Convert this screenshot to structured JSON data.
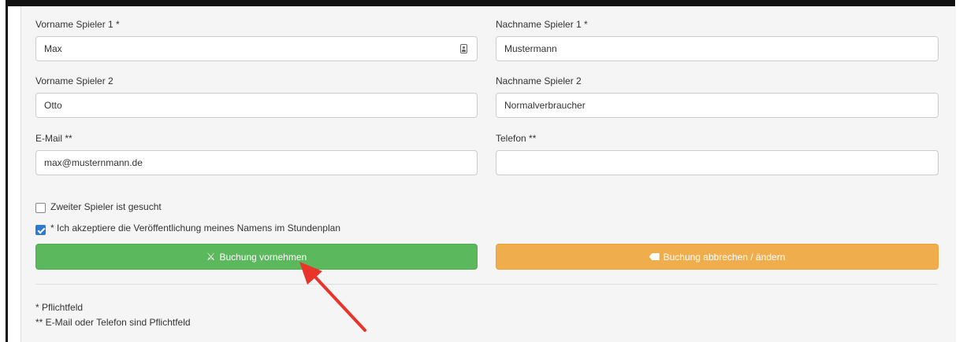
{
  "form": {
    "first_name_1": {
      "label": "Vorname Spieler 1 *",
      "value": "Max"
    },
    "last_name_1": {
      "label": "Nachname Spieler 1 *",
      "value": "Mustermann"
    },
    "first_name_2": {
      "label": "Vorname Spieler 2",
      "value": "Otto"
    },
    "last_name_2": {
      "label": "Nachname Spieler 2",
      "value": "Normalverbraucher"
    },
    "email": {
      "label": "E-Mail **",
      "value": "max@musternmann.de"
    },
    "phone": {
      "label": "Telefon **",
      "value": ""
    }
  },
  "checkboxes": {
    "second_player": {
      "label": "Zweiter Spieler ist gesucht",
      "checked": false
    },
    "publish_consent": {
      "label": "* Ich akzeptiere die Veröffentlichung meines Namens im Stundenplan",
      "checked": true
    }
  },
  "buttons": {
    "book": {
      "label": "Buchung vornehmen",
      "icon": "booking-icon",
      "color": "#5cb85c"
    },
    "cancel": {
      "label": "Buchung abbrechen / ändern",
      "icon": "backspace-icon",
      "color": "#f0ad4e"
    }
  },
  "notes": {
    "required": "* Pflichtfeld",
    "contact_required": "** E-Mail oder Telefon sind Pflichtfeld"
  },
  "annotation": {
    "arrow_color": "#e8342a"
  }
}
